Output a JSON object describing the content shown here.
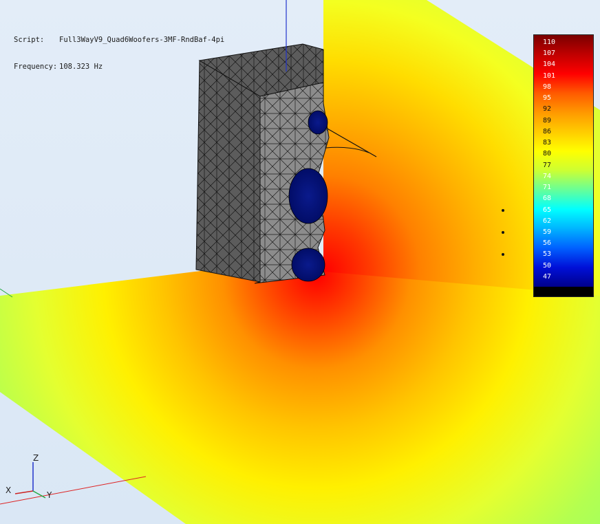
{
  "header": {
    "script_label": "Script:",
    "script_value": "Full3WayV9_Quad6Woofers-3MF-RndBaf-4pi",
    "frequency_label": "Frequency:",
    "frequency_value": "108.323 Hz"
  },
  "colorbar": {
    "ticks": [
      "110",
      "107",
      "104",
      "101",
      "98",
      "95",
      "92",
      "89",
      "86",
      "83",
      "80",
      "77",
      "74",
      "71",
      "68",
      "65",
      "62",
      "59",
      "56",
      "53",
      "50",
      "47"
    ],
    "stops": [
      "#7a0000",
      "#c00000",
      "#ff0000",
      "#ff5a00",
      "#ff9900",
      "#ffcc00",
      "#ffff00",
      "#ccff33",
      "#66ff99",
      "#00ffff",
      "#00b4ff",
      "#0060ff",
      "#0010d8",
      "#00008c"
    ]
  },
  "axes": {
    "x": "X",
    "y": "Y",
    "z": "Z"
  }
}
